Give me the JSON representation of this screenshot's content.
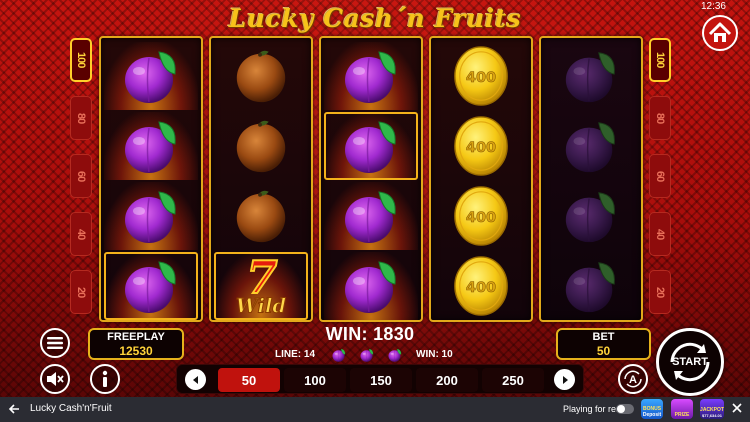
{
  "status_bar": {
    "time": "12:36"
  },
  "game": {
    "title": "Lucky Cash´n Fruits",
    "line_numbers": [
      "100",
      "80",
      "60",
      "40",
      "20"
    ],
    "reels": [
      [
        "plum",
        "plum",
        "plum",
        "plum"
      ],
      [
        "orange",
        "orange",
        "orange",
        "seven_wild"
      ],
      [
        "plum",
        "plum",
        "plum",
        "plum"
      ],
      [
        "coin",
        "coin",
        "coin",
        "coin"
      ],
      [
        "plum_dim",
        "plum_dim",
        "plum_dim",
        "plum_dim"
      ]
    ],
    "coin_value": "400",
    "wild_label": "Wild",
    "seven_label": "7",
    "freeplay": {
      "label": "FREEPLAY",
      "value": "12530"
    },
    "bet": {
      "label": "BET",
      "value": "50"
    },
    "win": {
      "text": "WIN: 1830"
    },
    "line_win": {
      "line_text": "LINE: 14",
      "win_text": "WIN: 10",
      "symbol": "plum",
      "symbol_count": 3
    },
    "bet_options": [
      "50",
      "100",
      "150",
      "200",
      "250"
    ],
    "selected_bet": "50",
    "start_label": "START",
    "auto_label": "A",
    "icons": {
      "menu": "menu-icon",
      "sound": "sound-muted-icon",
      "info": "info-icon",
      "home": "home-icon",
      "prev": "chevron-left-icon",
      "next": "chevron-right-icon"
    },
    "colors": {
      "gold": "#f7c21a",
      "background_red": "#c4140f",
      "selected_bet": "#c0120d"
    }
  },
  "footer": {
    "back_icon": "arrow-left-icon",
    "game_name": "Lucky Cash'n'Fruit",
    "playing_for_real": "Playing for real",
    "badges": [
      {
        "name": "bonus-deposit",
        "label": "Deposit",
        "title": "BONUS"
      },
      {
        "name": "prize-game",
        "label": "",
        "title": "PRIZE"
      },
      {
        "name": "jackpot",
        "label": "$77,634.01",
        "title": "JACKPOT"
      }
    ],
    "close_icon": "close-icon"
  }
}
